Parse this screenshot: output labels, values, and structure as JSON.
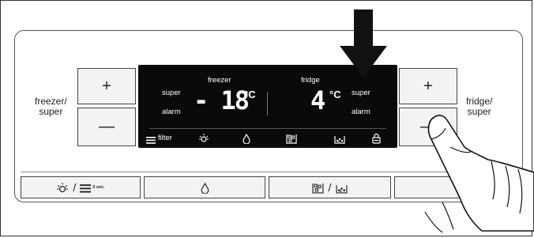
{
  "left_label": [
    "freezer/",
    "super"
  ],
  "right_label": [
    "fridge/",
    "super"
  ],
  "freezer_plus": "+",
  "freezer_minus": "—",
  "fridge_plus": "+",
  "fridge_minus": "—",
  "display": {
    "freezer_title": "freezer",
    "fridge_title": "fridge",
    "freezer_super": "super",
    "freezer_alarm": "alarm",
    "fridge_super": "super",
    "fridge_alarm": "alarm",
    "freezer_temp": "- 18",
    "fridge_temp": "4",
    "unit": "°C",
    "filter_label": "filter",
    "icons": [
      "filter-icon",
      "light-icon",
      "water-drop-icon",
      "ice-cubes-icon",
      "crushed-ice-icon",
      "lock-icon"
    ]
  },
  "bottom_buttons": {
    "light_filter": {
      "separator": "/",
      "hold": "3 sec."
    },
    "water": {},
    "ice": {
      "separator": "/"
    },
    "lock": {}
  }
}
